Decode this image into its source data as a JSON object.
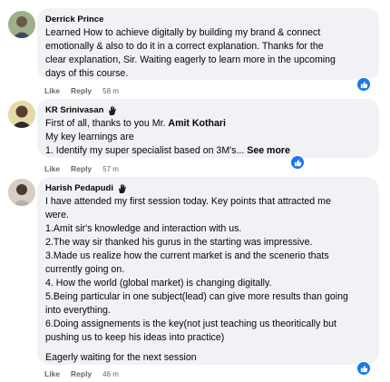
{
  "comments": [
    {
      "author": "Derrick Prince",
      "lines": [
        "Learned How to achieve digitally by building my brand & connect",
        "emotionally & also to do it in a correct explanation. Thanks for the",
        "clear explanation, Sir. Waiting eagerly to learn more in the upcoming",
        "days of this course."
      ],
      "like": "Like",
      "reply": "Reply",
      "time": "58 m"
    },
    {
      "author": "KR Srinivasan",
      "badge": "hand-badge-icon",
      "line1_prefix": "First of all, thanks to you Mr. ",
      "line1_bold": "Amit Kothari",
      "line2": "My key learnings are",
      "line3": "1. Identify my super specialist based on 3M's... ",
      "see_more": "See more",
      "like": "Like",
      "reply": "Reply",
      "time": "57 m"
    },
    {
      "author": "Harish Pedapudi",
      "badge": "hand-badge-icon",
      "lines": [
        "I have attended my first session today. Key points that attracted me",
        "were.",
        "1.Amit sir's knowledge and interaction with us.",
        "2.The way sir thanked his gurus in the starting was impressive.",
        "3.Made us realize how the current market is and the scenerio thats",
        "currently going on.",
        "4. How the world (global market) is changing digitally.",
        "5.Being particular in one subject(lead) can give more results than going",
        "into everything.",
        "6.Doing assignements is the key(not just teaching us theoritically but",
        "pushing us to keep his ideas into practice)",
        "",
        "Eagerly waiting for the next session"
      ],
      "like": "Like",
      "reply": "Reply",
      "time": "46 m"
    }
  ],
  "colors": {
    "bubble": "#f0f2f5",
    "meta": "#65676b",
    "like_blue": "#1877f2"
  }
}
